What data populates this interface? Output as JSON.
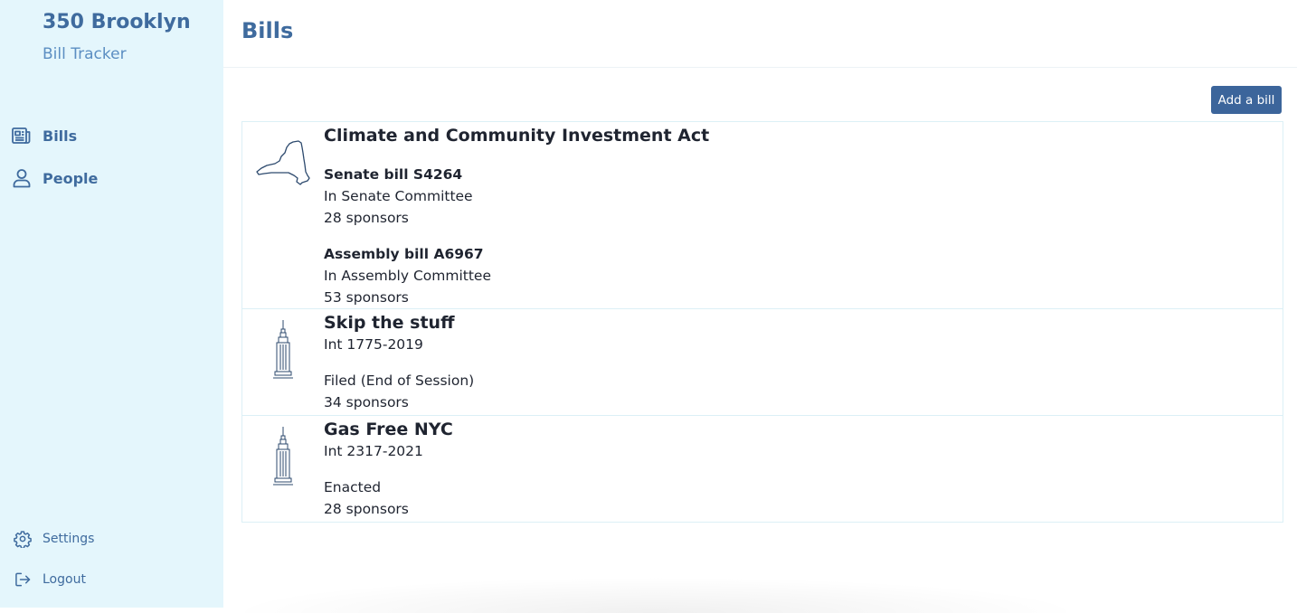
{
  "brand": {
    "title": "350 Brooklyn",
    "subtitle": "Bill Tracker"
  },
  "nav": [
    {
      "label": "Bills",
      "icon": "newspaper-icon"
    },
    {
      "label": "People",
      "icon": "person-icon"
    }
  ],
  "nav_bottom": [
    {
      "label": "Settings",
      "icon": "gear-icon"
    },
    {
      "label": "Logout",
      "icon": "logout-icon"
    }
  ],
  "page": {
    "title": "Bills"
  },
  "actions": {
    "add_bill": "Add a bill"
  },
  "bills": [
    {
      "title": "Climate and Community Investment Act",
      "icon": "new-york-state-icon",
      "senate": {
        "label": "Senate bill S4264",
        "status": "In Senate Committee",
        "sponsors": "28 sponsors"
      },
      "assembly": {
        "label": "Assembly bill A6967",
        "status": "In Assembly Committee",
        "sponsors": "53 sponsors"
      }
    },
    {
      "title": "Skip the stuff",
      "icon": "empire-state-building-icon",
      "number": "Int 1775-2019",
      "status": "Filed (End of Session)",
      "sponsors": "34 sponsors"
    },
    {
      "title": "Gas Free NYC",
      "icon": "empire-state-building-icon",
      "number": "Int 2317-2021",
      "status": "Enacted",
      "sponsors": "28 sponsors"
    }
  ],
  "colors": {
    "sidebar_bg": "#e4f6fc",
    "accent": "#3f6b9e",
    "button_bg": "#3c659b"
  }
}
